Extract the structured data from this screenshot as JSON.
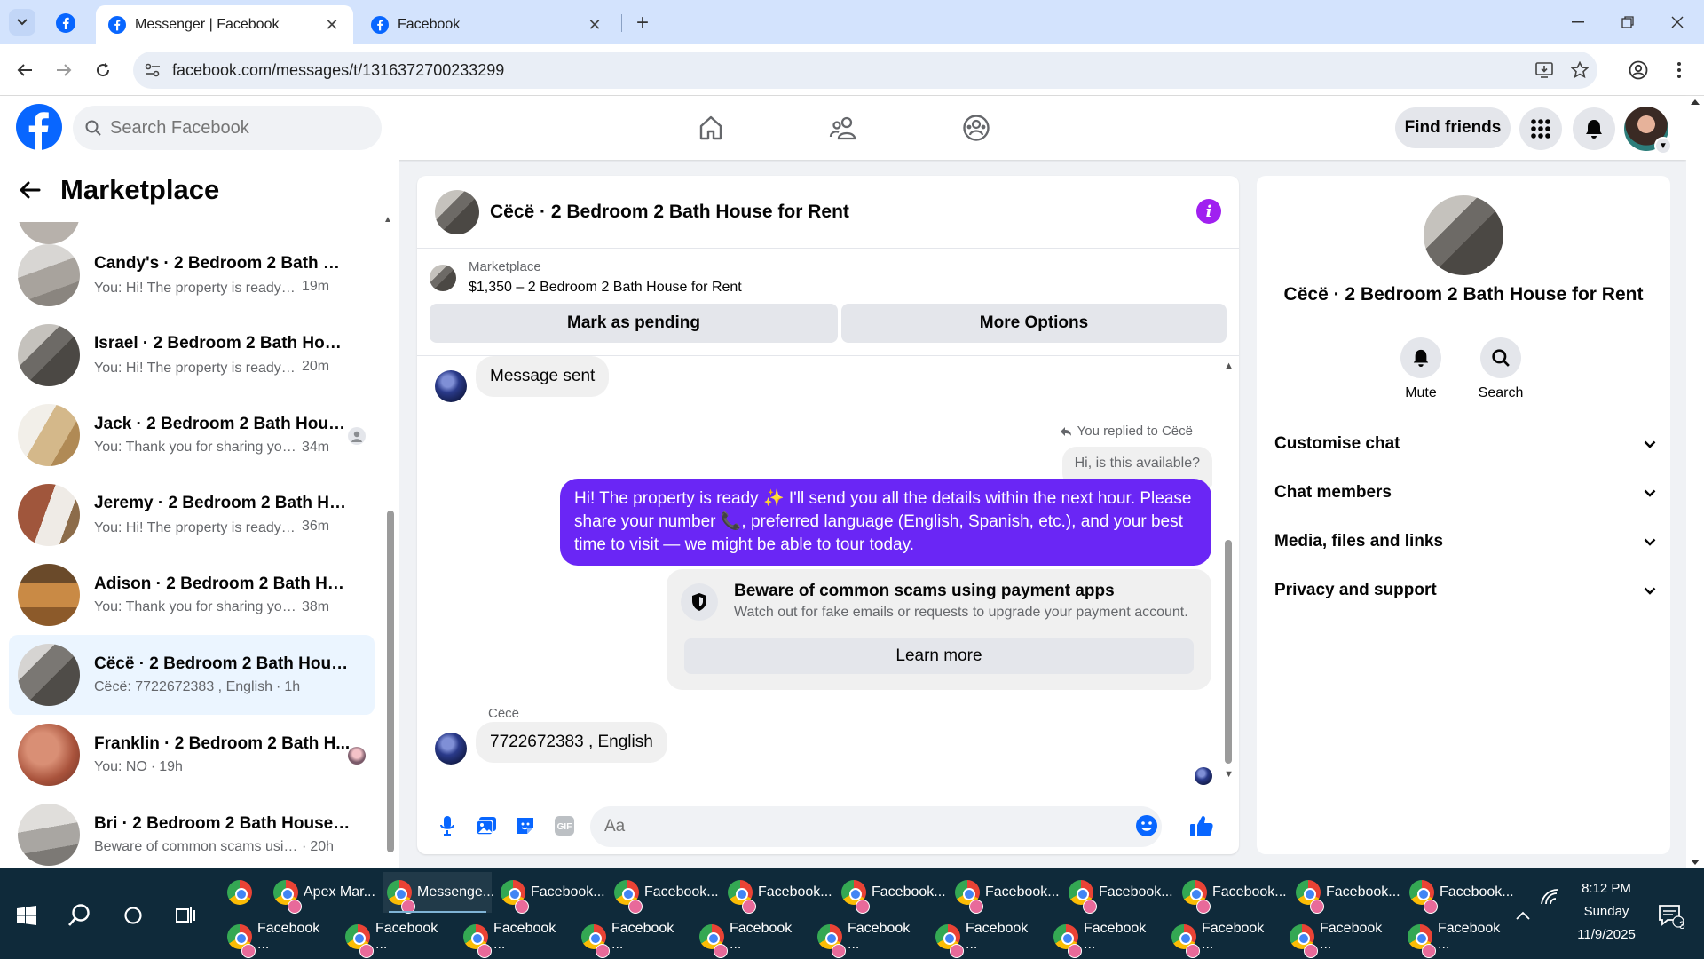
{
  "browser": {
    "tabs": [
      {
        "title": "Messenger | Facebook",
        "active": true
      },
      {
        "title": "Facebook",
        "active": false
      }
    ],
    "url": "facebook.com/messages/t/1316372700233299"
  },
  "fb": {
    "search_placeholder": "Search Facebook",
    "find_friends": "Find friends"
  },
  "sidebar": {
    "title": "Marketplace",
    "conversations": [
      {
        "name": "Candy's · 2 Bedroom 2 Bath Hou...",
        "preview": "You: Hi! The property is ready ✨...",
        "time": "19m",
        "thumb": "room1",
        "active": false
      },
      {
        "name": "Israel · 2 Bedroom 2 Bath House...",
        "preview": "You: Hi! The property is ready ✨...",
        "time": "20m",
        "thumb": "room2",
        "active": false
      },
      {
        "name": "Jack · 2 Bedroom 2 Bath Hous...",
        "preview": "You: Thank you for sharing you...",
        "time": "34m",
        "thumb": "room3",
        "active": false
      },
      {
        "name": "Jeremy · 2 Bedroom 2 Bath Hou...",
        "preview": "You: Hi! The property is ready ✨...",
        "time": "36m",
        "thumb": "room4",
        "active": false
      },
      {
        "name": "Adison · 2 Bedroom 2 Bath Hou...",
        "preview": "You: Thank you for sharing your n...",
        "time": "38m",
        "thumb": "room5",
        "active": false
      },
      {
        "name": "Cëcë · 2 Bedroom 2 Bath House ...",
        "preview": "Cëcë: 7722672383 , English",
        "time": "1h",
        "thumb": "room6",
        "active": true
      },
      {
        "name": "Franklin · 2 Bedroom 2 Bath H...",
        "preview": "You: NO",
        "time": "19h",
        "thumb": "room7",
        "active": false
      },
      {
        "name": "Bri · 2 Bedroom 2 Bath House fo...",
        "preview": "Beware of common scams using p...",
        "time": "20h",
        "thumb": "room8",
        "active": false
      }
    ]
  },
  "chat": {
    "title": "Cëcë · 2 Bedroom 2 Bath House for Rent",
    "marketplace_label": "Marketplace",
    "listing": "$1,350 – 2 Bedroom 2 Bath House for Rent",
    "mark_pending": "Mark as pending",
    "more_options": "More Options",
    "message_sent": "Message sent",
    "replied_label": "You replied to Cëcë",
    "quoted": "Hi, is this available?",
    "outgoing": "Hi! The property is ready ✨ I'll send you all the details within the next hour. Please share your number 📞, preferred language (English, Spanish, etc.), and your best time to visit — we might be able to tour today.",
    "scam_title": "Beware of common scams using payment apps",
    "scam_sub": "Watch out for fake emails or requests to upgrade your payment account.",
    "learn_more": "Learn more",
    "sender": "Cëcë",
    "incoming": "7722672383 , English",
    "composer_placeholder": "Aa"
  },
  "info_panel": {
    "title": "Cëcë · 2 Bedroom 2 Bath House for Rent",
    "actions": [
      "Mute",
      "Search"
    ],
    "rows": [
      "Customise chat",
      "Chat members",
      "Media, files and links",
      "Privacy and support"
    ]
  },
  "taskbar": {
    "row1": [
      "Apex Mar...",
      "Messenge...",
      "Facebook...",
      "Facebook...",
      "Facebook...",
      "Facebook...",
      "Facebook...",
      "Facebook...",
      "Facebook...",
      "Facebook...",
      "Facebook..."
    ],
    "row2": [
      "Facebook ...",
      "Facebook ...",
      "Facebook ...",
      "Facebook ...",
      "Facebook ...",
      "Facebook ...",
      "Facebook ...",
      "Facebook ...",
      "Facebook ...",
      "Facebook ...",
      "Facebook ..."
    ],
    "time": "8:12 PM",
    "day": "Sunday",
    "date": "11/9/2025",
    "notif_count": "3"
  },
  "colors": {
    "fb_blue": "#0866ff",
    "messenger_purple": "#6a26f5",
    "active_conv": "#ebf5ff",
    "info_icon": "#a020f0"
  }
}
